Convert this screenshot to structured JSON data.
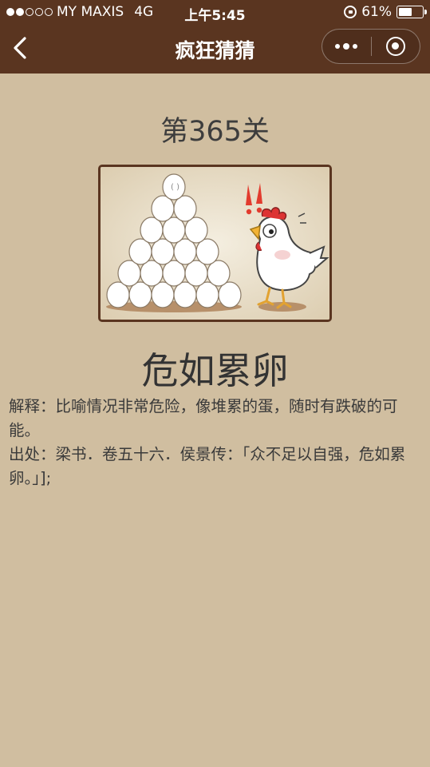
{
  "status_bar": {
    "carrier": "MY MAXIS",
    "network": "4G",
    "time": "上午5:45",
    "battery": "61%",
    "battery_level": 0.61,
    "signal_bars": 2
  },
  "nav": {
    "title": "疯狂猜猜",
    "back_icon": "chevron-left-icon",
    "more_icon": "more-dots-icon",
    "close_icon": "target-circle-icon"
  },
  "level": {
    "title": "第365关"
  },
  "answer": "危如累卵",
  "explanation": {
    "line1": "解释：比喻情况非常危险，像堆累的蛋，随时有跌破的可能。",
    "line2": "出处：梁书．卷五十六．侯景传：「众不足以自强，危如累卵。」];"
  },
  "colors": {
    "topbar": "#5a3520",
    "background": "#d0bea0"
  }
}
